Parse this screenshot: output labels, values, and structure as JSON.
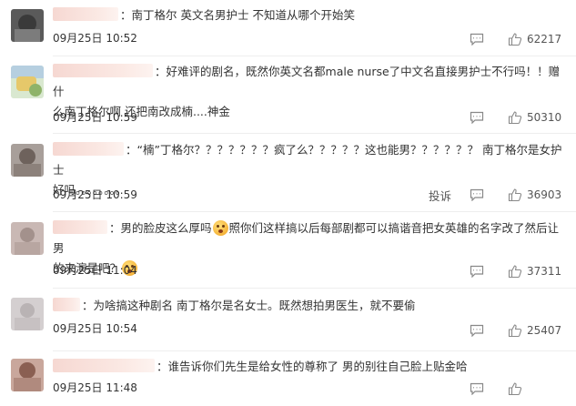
{
  "comments": [
    {
      "text_lines": [
        "南丁格尔 英文名男护士 不知道从哪个开始笑"
      ],
      "time": "09月25日 10:52",
      "likes": "62217",
      "report": ""
    },
    {
      "text_lines": [
        "好难评的剧名，既然你英文名都male nurse了中文名直接男护士不行吗！！赠什",
        "么南丁格尔啊 还把南改成楠....神金"
      ],
      "time": "09月25日 10:59",
      "likes": "50310",
      "report": ""
    },
    {
      "text_lines": [
        "“楠”丁格尔？？？？？？？疯了么？？？？？这也能男？？？？？？ 南丁格尔是女护士",
        "好吗。。。。。。。。"
      ],
      "time": "09月25日 10:59",
      "likes": "36903",
      "report": "投诉"
    },
    {
      "text_lines": [
        "男的脸皮这么厚吗",
        "照你们这样搞以后每部剧都可以搞谐音把女英雄的名字改了然后让男",
        "的来演是吧？"
      ],
      "time": "09月25日 11:04",
      "likes": "37311",
      "report": ""
    },
    {
      "text_lines": [
        "为啥搞这种剧名 南丁格尔是名女士。既然想拍男医生，就不要偷"
      ],
      "time": "09月25日 10:54",
      "likes": "25407",
      "report": ""
    },
    {
      "text_lines": [
        "谁告诉你们先生是给女性的尊称了 男的别往自己脸上贴金哈"
      ],
      "time": "09月25日 11:48",
      "likes": "",
      "report": ""
    }
  ],
  "icons": {
    "reply": "comment-icon",
    "like": "thumbs-up-icon"
  },
  "colors": {
    "text": "#333333",
    "meta": "#555555",
    "divider": "#eeeeee",
    "name_blur": "#f6d8d2"
  }
}
